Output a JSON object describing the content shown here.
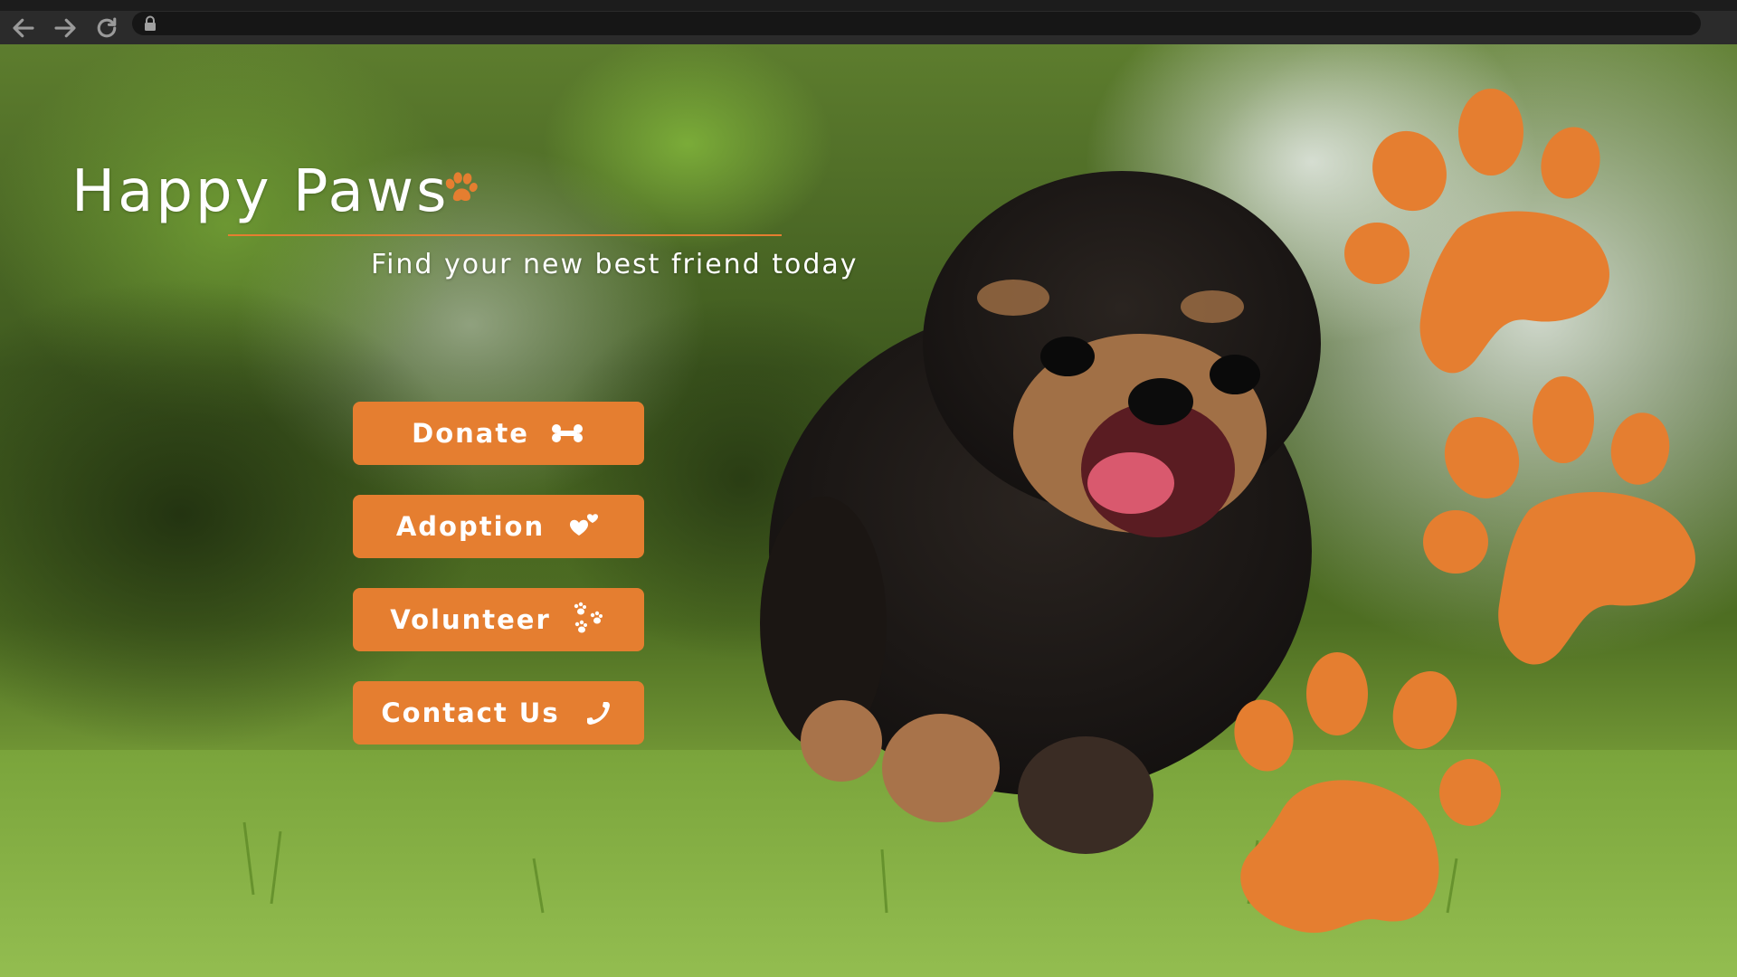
{
  "browser": {
    "back_icon": "arrow-left-icon",
    "forward_icon": "arrow-right-icon",
    "reload_icon": "reload-icon",
    "lock_icon": "lock-icon",
    "address": ""
  },
  "brand": {
    "title": "Happy Paws",
    "title_icon": "paw-icon",
    "tagline": "Find your new best friend today"
  },
  "menu": [
    {
      "label": "Donate",
      "icon": "bone-icon"
    },
    {
      "label": "Adoption",
      "icon": "hearts-icon"
    },
    {
      "label": "Volunteer",
      "icon": "paw-prints-icon"
    },
    {
      "label": "Contact Us",
      "icon": "phone-icon"
    }
  ],
  "colors": {
    "accent": "#e57e30",
    "text": "#ffffff",
    "browser_bar": "#2b2b2b"
  }
}
